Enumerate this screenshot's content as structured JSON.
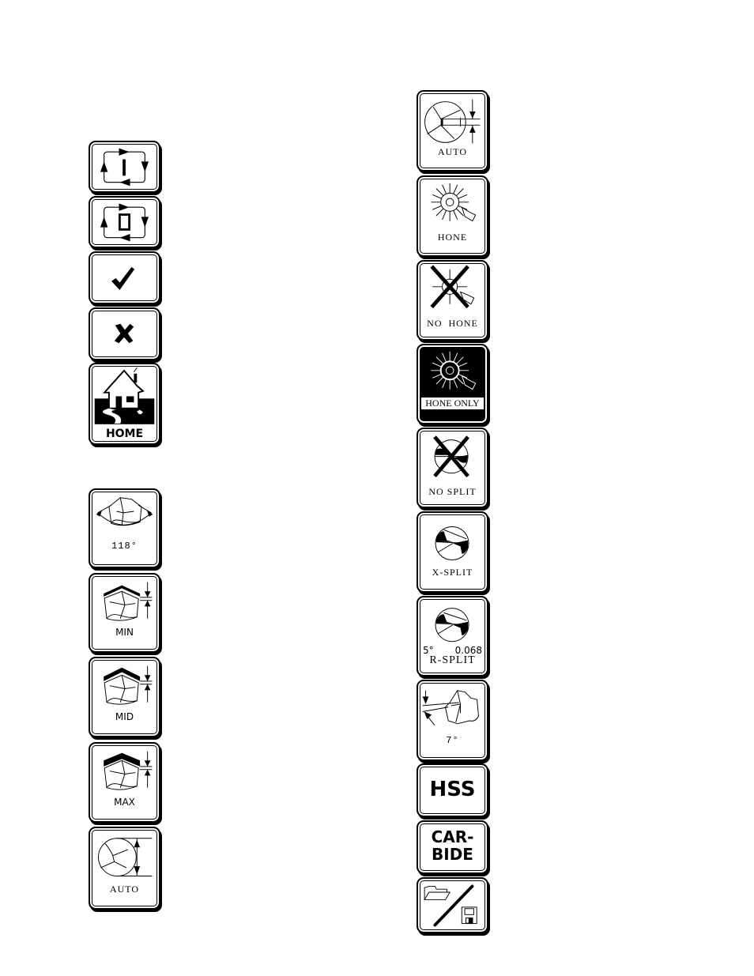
{
  "left_column": {
    "buttons": [
      {
        "id": "cycle-in",
        "label": "",
        "icon": "cycle-arrows-with-I-icon",
        "glyph": "I"
      },
      {
        "id": "cycle-out",
        "label": "",
        "icon": "cycle-arrows-with-O-icon",
        "glyph": "O"
      },
      {
        "id": "confirm",
        "label": "",
        "icon": "checkmark-icon",
        "glyph": "✓"
      },
      {
        "id": "cancel",
        "label": "",
        "icon": "x-cross-icon",
        "glyph": "✖"
      },
      {
        "id": "home",
        "label": "HOME",
        "icon": "house-icon"
      },
      {
        "id": "point-angle",
        "label": "118°",
        "icon": "drill-point-angle-icon"
      },
      {
        "id": "grind-min",
        "label": "MIN",
        "icon": "drill-grind-min-icon"
      },
      {
        "id": "grind-mid",
        "label": "MID",
        "icon": "drill-grind-mid-icon"
      },
      {
        "id": "grind-max",
        "label": "MAX",
        "icon": "drill-grind-max-icon"
      },
      {
        "id": "diameter-auto",
        "label": "AUTO",
        "icon": "drill-diameter-auto-icon"
      }
    ]
  },
  "right_column": {
    "buttons": [
      {
        "id": "web-auto",
        "label": "AUTO",
        "icon": "web-thickness-auto-icon"
      },
      {
        "id": "hone",
        "label": "HONE",
        "icon": "hone-wheel-icon"
      },
      {
        "id": "no-hone",
        "label": "NO  HONE",
        "icon": "no-hone-icon"
      },
      {
        "id": "hone-only",
        "label": "HONE ONLY",
        "icon": "hone-only-icon",
        "selected": true
      },
      {
        "id": "no-split",
        "label": "NO SPLIT",
        "icon": "no-split-icon"
      },
      {
        "id": "x-split",
        "label": "X-SPLIT",
        "icon": "x-split-icon"
      },
      {
        "id": "r-split",
        "label": "R-SPLIT",
        "icon": "r-split-icon",
        "angle": "5°",
        "value": "0.068"
      },
      {
        "id": "relief-angle",
        "label": "7°",
        "icon": "relief-angle-icon"
      },
      {
        "id": "hss",
        "label": "HSS",
        "icon": "hss-material-icon"
      },
      {
        "id": "carbide",
        "label_line1": "CAR-",
        "label_line2": "BIDE",
        "icon": "carbide-material-icon"
      },
      {
        "id": "open-save",
        "label": "",
        "icon": "folder-open-save-icon"
      }
    ]
  },
  "colors": {
    "foreground": "#000000",
    "background": "#ffffff"
  }
}
